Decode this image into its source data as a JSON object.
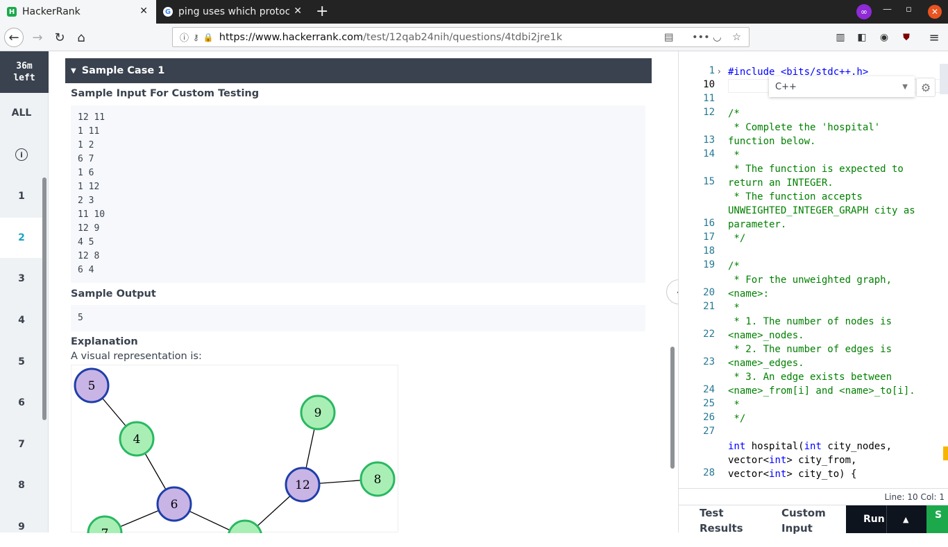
{
  "browser": {
    "tabs": [
      {
        "title": "HackerRank",
        "favicon": "hackerrank-icon"
      },
      {
        "title": "ping uses which protocol",
        "favicon": "google-icon"
      }
    ],
    "url_host": "https://www.hackerrank.com",
    "url_path": "/test/12qab24nih/questions/4tdbi2jre1k"
  },
  "sidebar": {
    "timer_value": "36m",
    "timer_unit": "left",
    "all_label": "ALL",
    "items": [
      "1",
      "2",
      "3",
      "4",
      "5",
      "6",
      "7",
      "8",
      "9"
    ],
    "active_item": "2"
  },
  "problem": {
    "sample_case_title": "Sample Case 1",
    "sample_input_label": "Sample Input For Custom Testing",
    "sample_input_lines": [
      "12 11",
      "1 11",
      "1 2",
      "6 7",
      "1 6",
      "1 12",
      "2 3",
      "11 10",
      "12 9",
      "4 5",
      "12 8",
      "6 4"
    ],
    "sample_output_label": "Sample Output",
    "sample_output_value": "5",
    "explanation_label": "Explanation",
    "explanation_text": "A visual representation is:",
    "graph_nodes": [
      "5",
      "4",
      "9",
      "12",
      "8",
      "6",
      "7"
    ]
  },
  "editor": {
    "language": "C++",
    "status": "Line: 10 Col: 1",
    "run_label": "Run",
    "submit_label": "S",
    "test_results_label_1": "Test",
    "test_results_label_2": "Results",
    "custom_input_label_1": "Custom",
    "custom_input_label_2": "Input",
    "line_numbers": [
      "1",
      "10",
      "11",
      "12",
      "13",
      "14",
      "15",
      "16",
      "17",
      "18",
      "19",
      "20",
      "21",
      "22",
      "23",
      "24",
      "25",
      "26",
      "27",
      "28"
    ],
    "code_lines": [
      "#include <bits/stdc++.h>",
      "",
      "/*",
      " * Complete the 'hospital'",
      "function below.",
      " *",
      " * The function is expected to",
      "return an INTEGER.",
      " * The function accepts",
      "UNWEIGHTED_INTEGER_GRAPH city as",
      "parameter.",
      " */",
      "",
      "/*",
      " * For the unweighted graph,",
      "<name>:",
      " *",
      " * 1. The number of nodes is",
      "<name>_nodes.",
      " * 2. The number of edges is",
      "<name>_edges.",
      " * 3. An edge exists between",
      "<name>_from[i] and <name>_to[i].",
      " *",
      " */",
      "",
      "int hospital(int city_nodes,",
      "vector<int> city_from,",
      "vector<int> city_to) {"
    ]
  }
}
